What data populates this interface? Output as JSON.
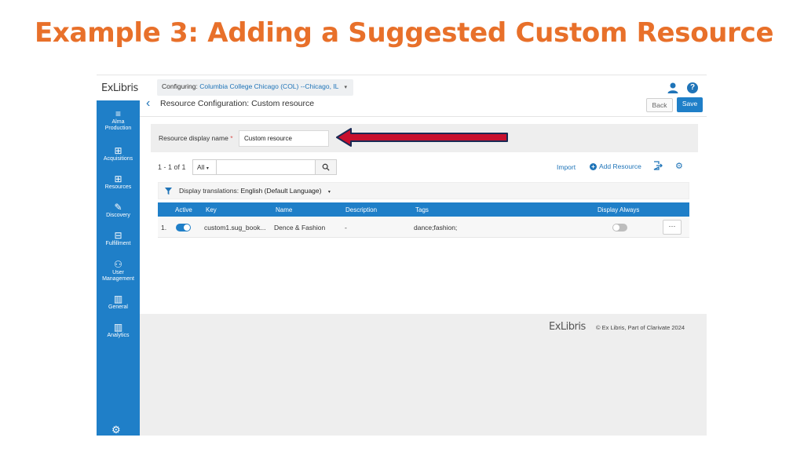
{
  "slide_title": "Example 3: Adding a Suggested Custom Resource",
  "topbar": {
    "logo": "ExLibris",
    "configuring_label": "Configuring:",
    "institution": "Columbia College Chicago (COL) --Chicago, IL",
    "user_icon": "user-icon",
    "help_icon": "help-icon",
    "help_glyph": "?"
  },
  "sidebar": {
    "items": [
      {
        "icon": "alma-production-icon",
        "glyph": "≡",
        "label_1": "Alma",
        "label_2": "Production"
      },
      {
        "icon": "acquisitions-icon",
        "glyph": "⊞",
        "label_1": "Acquisitions",
        "label_2": ""
      },
      {
        "icon": "resources-icon",
        "glyph": "⊞",
        "label_1": "Resources",
        "label_2": ""
      },
      {
        "icon": "discovery-icon",
        "glyph": "✎",
        "label_1": "Discovery",
        "label_2": ""
      },
      {
        "icon": "fulfillment-icon",
        "glyph": "⊟",
        "label_1": "Fulfillment",
        "label_2": ""
      },
      {
        "icon": "user-management-icon",
        "glyph": "⚇",
        "label_1": "User",
        "label_2": "Management"
      },
      {
        "icon": "general-icon",
        "glyph": "▥",
        "label_1": "General",
        "label_2": ""
      },
      {
        "icon": "analytics-icon",
        "glyph": "▥",
        "label_1": "Analytics",
        "label_2": ""
      }
    ],
    "settings_glyph": "⚙"
  },
  "header": {
    "back_glyph": "‹",
    "title": "Resource Configuration: Custom resource",
    "back_button": "Back",
    "save_button": "Save"
  },
  "name_panel": {
    "label": "Resource display name",
    "required_mark": "*",
    "value": "Custom resource"
  },
  "toolbar": {
    "record_count": "1 - 1 of 1",
    "filter_value": "All",
    "filter_caret": "▾",
    "import_label": "Import",
    "add_resource_plus": "+",
    "add_resource_label": "Add Resource",
    "gear_glyph": "⚙"
  },
  "translations": {
    "label": "Display translations:",
    "language": "English (Default Language)",
    "caret": "▾"
  },
  "table": {
    "columns": [
      "Active",
      "Key",
      "Name",
      "Description",
      "Tags",
      "Display Always"
    ],
    "rows": [
      {
        "index": "1.",
        "active": true,
        "key": "custom1.sug_book...",
        "name": "Dence & Fashion",
        "description": "-",
        "tags": "dance;fashion;",
        "display_always": false,
        "menu": "···"
      }
    ]
  },
  "footer": {
    "logo": "ExLibris",
    "copyright": "© Ex Libris, Part of Clarivate  2024"
  },
  "colors": {
    "title_orange": "#e8702a",
    "alma_blue": "#1f7fc8",
    "arrow_red": "#c8102e",
    "arrow_outline": "#1a2a55"
  }
}
